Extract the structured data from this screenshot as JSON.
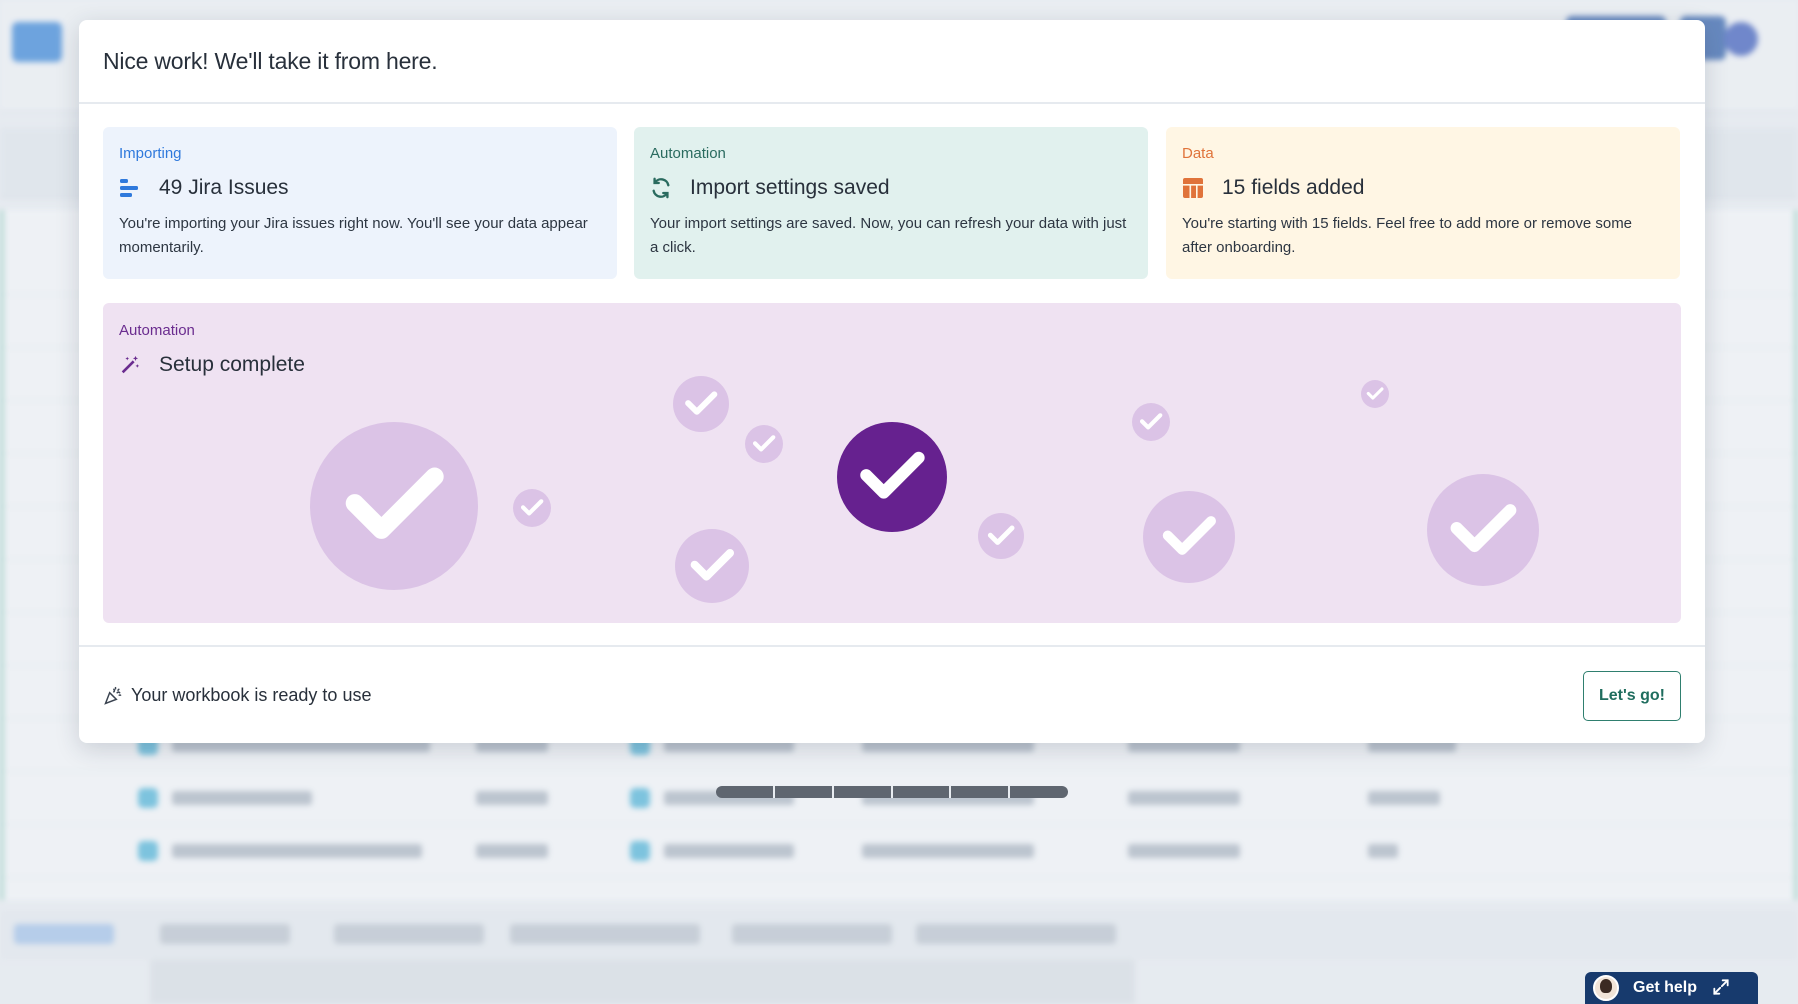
{
  "modal": {
    "title": "Nice work! We'll take it from here.",
    "cards": [
      {
        "category": "Importing",
        "heading": "49 Jira Issues",
        "description": "You're importing your Jira issues right now. You'll see your data appear momentarily.",
        "icon": "import-bars-icon",
        "accent": "#2f79dc"
      },
      {
        "category": "Automation",
        "heading": "Import settings saved",
        "description": "Your import settings are saved. Now, you can refresh your data with just a click.",
        "icon": "refresh-icon",
        "accent": "#2a6b5f"
      },
      {
        "category": "Data",
        "heading": "15 fields added",
        "description": "You're starting with 15 fields. Feel free to add more or remove some after onboarding.",
        "icon": "table-icon",
        "accent": "#e0733a"
      }
    ],
    "automation_panel": {
      "category": "Automation",
      "heading": "Setup complete",
      "icon": "magic-wand-icon",
      "accent": "#6a2c8f"
    },
    "footer": {
      "text": "Your workbook is ready to use",
      "icon": "party-popper-icon",
      "button_label": "Let's go!"
    }
  },
  "help_widget": {
    "label": "Get help",
    "icon": "expand-icon"
  },
  "colors": {
    "check_primary": "#66218f",
    "check_faded": "#dbc3e6"
  }
}
